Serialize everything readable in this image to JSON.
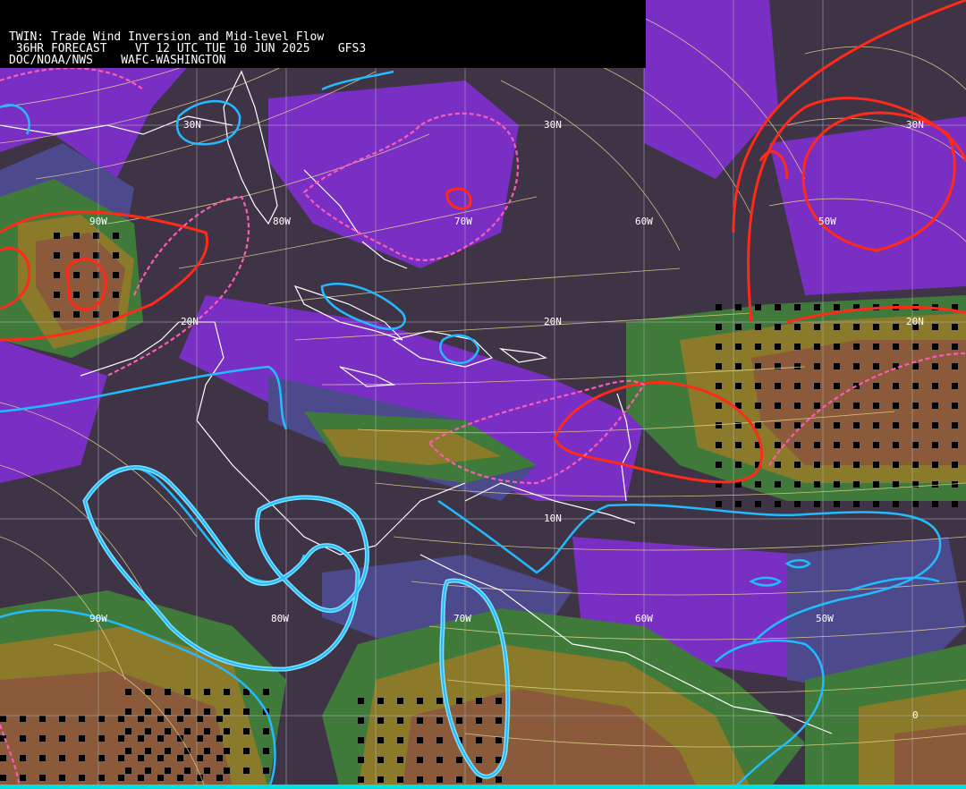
{
  "header": {
    "line1": "TWIN: Trade Wind Inversion and Mid-level Flow",
    "line2": " 36HR FORECAST    VT 12 UTC TUE 10 JUN 2025    GFS3",
    "line3": "DOC/NOAA/NWS    WAFC-WASHINGTON"
  },
  "grid_labels": {
    "lat_30n_west": "30N",
    "lat_30n_center": "30N",
    "lat_30n_east": "30N",
    "lat_20n_west": "20N",
    "lat_20n_center": "20N",
    "lat_20n_east": "20N",
    "lat_10n": "10N",
    "lon_90w_top": "90W",
    "lon_80w_top": "80W",
    "lon_70w_top": "70W",
    "lon_60w_top": "60W",
    "lon_50w_top": "50W",
    "lon_90w_bottom": "90W",
    "lon_80w_bottom": "80W",
    "lon_70w_bottom": "70W",
    "lon_60w_bottom": "60W",
    "lon_50w_bottom": "50W",
    "lat_0": "0"
  },
  "colors": {
    "background": "#3e3446",
    "purple": "#7a2fc4",
    "slate_blue": "#4c4a8c",
    "green": "#3f7a3a",
    "olive": "#8a7a2a",
    "brown": "#8a5a3a",
    "red_contour": "#ff2a1a",
    "pink_dashed": "#ff5ab4",
    "cyan_contour": "#22bbff",
    "streamline": "#e8d890",
    "coastline": "#ffffff",
    "gridline": "#b8b8b8"
  }
}
